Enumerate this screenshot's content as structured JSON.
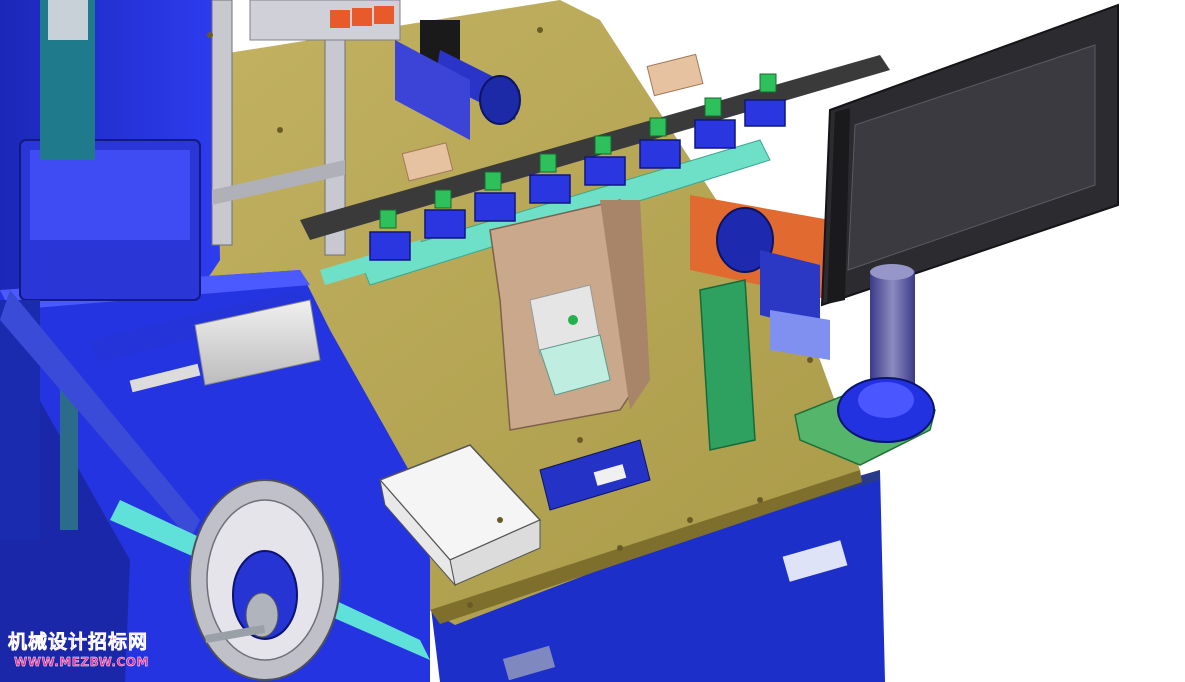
{
  "scene": {
    "subject": "automated-assembly-machine-cad-render",
    "colors": {
      "background": "#ffffff",
      "deck": "#b9a855",
      "frame_blue": "#1f2fd8",
      "rail_cyan": "#6fe0c8",
      "fixture_tan": "#c9a88b",
      "pedestal_green": "#55b66b",
      "monitor": "#2b2b30"
    }
  },
  "watermark": {
    "site_name": "机械设计招标网",
    "url": "WWW.MEZBW.COM"
  }
}
